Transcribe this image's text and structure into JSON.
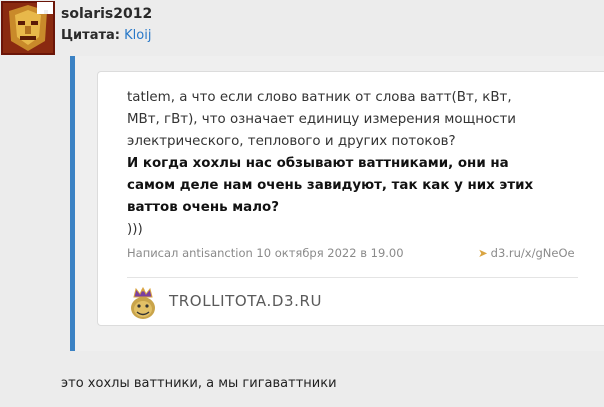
{
  "post": {
    "username": "solaris2012",
    "quote_label": "Цитата:",
    "quoted_user": "Kloij"
  },
  "card": {
    "line1": "tatlem, а что если слово ватник от слова ватт(Вт, кВт,",
    "line2": "МВт, гВт), что означает единицу измерения мощности",
    "line3": "электрического, теплового и других потоков?",
    "bold1": "И когда хохлы нас обзывают ваттниками, они на",
    "bold2": "самом деле нам очень завидуют, так как у них этих",
    "bold3": "ваттов очень мало?",
    "line4": ")))",
    "meta": "Написал antisanction 10 октября 2022 в 19.00",
    "link": "d3.ru/x/gNeOe",
    "brand": "TROLLITOTA.D3.RU"
  },
  "comment": "это хохлы ваттники, а мы гигаваттники",
  "colors": {
    "accent_bar": "#3b82c4",
    "link": "#2878c8"
  }
}
